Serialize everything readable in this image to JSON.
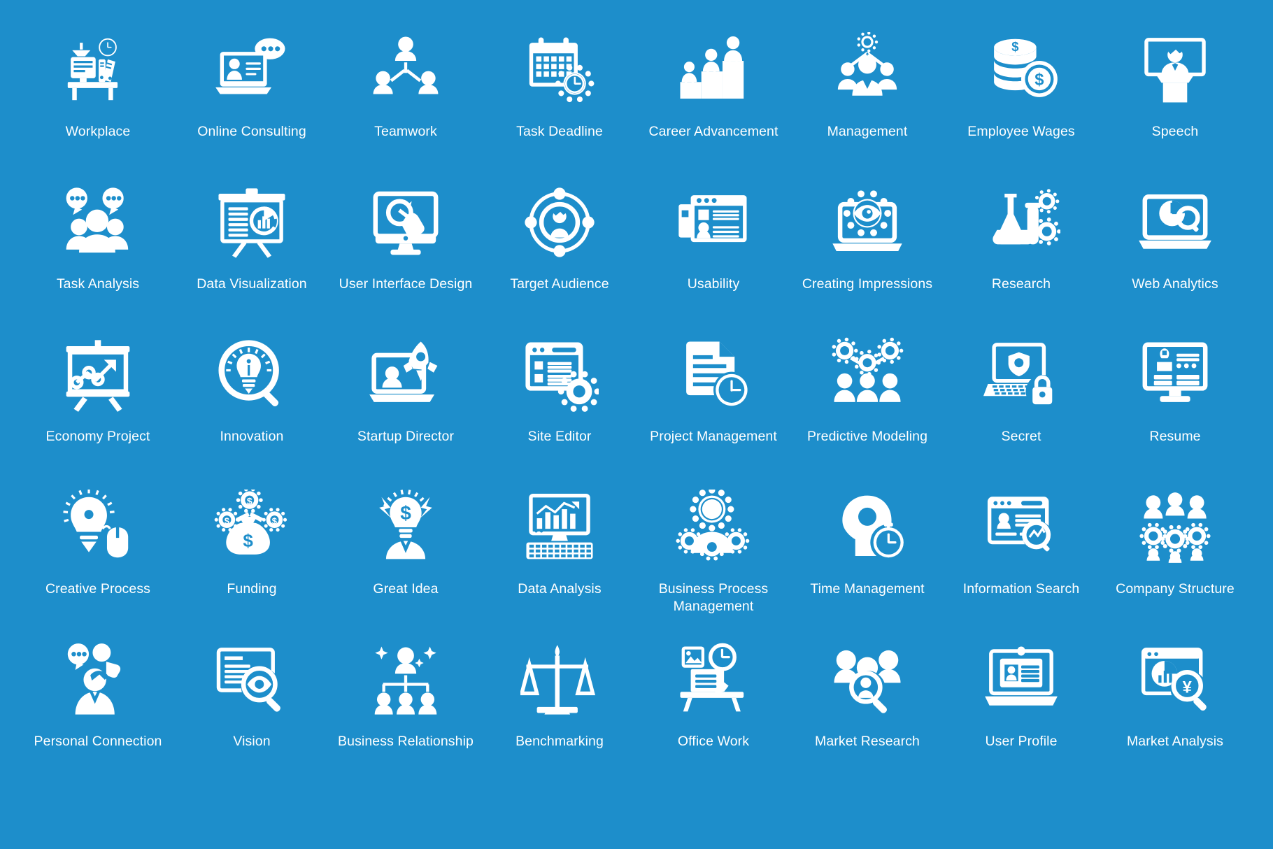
{
  "canvas": {
    "background_color": "#1d8ecb",
    "icon_color": "#ffffff",
    "columns": 8,
    "rows": 5,
    "total_icons": 40
  },
  "icons": [
    {
      "id": "workplace",
      "label": "Workplace",
      "icon_name": "desk-lamp-computer-clock-icon"
    },
    {
      "id": "online-consulting",
      "label": "Online Consulting",
      "icon_name": "laptop-user-chat-bubble-icon"
    },
    {
      "id": "teamwork",
      "label": "Teamwork",
      "icon_name": "three-people-hierarchy-icon"
    },
    {
      "id": "task-deadline",
      "label": "Task Deadline",
      "icon_name": "calendar-gear-clock-icon"
    },
    {
      "id": "career-advancement",
      "label": "Career Advancement",
      "icon_name": "people-on-steps-icon"
    },
    {
      "id": "management",
      "label": "Management",
      "icon_name": "team-gear-network-icon"
    },
    {
      "id": "employee-wages",
      "label": "Employee Wages",
      "icon_name": "coin-stack-dollar-icon"
    },
    {
      "id": "speech",
      "label": "Speech",
      "icon_name": "speaker-podium-screen-icon"
    },
    {
      "id": "task-analysis",
      "label": "Task Analysis",
      "icon_name": "people-speech-bubbles-icon"
    },
    {
      "id": "data-visualization",
      "label": "Data Visualization",
      "icon_name": "presentation-board-chart-icon"
    },
    {
      "id": "user-interface-design",
      "label": "User Interface Design",
      "icon_name": "monitor-cursor-click-icon"
    },
    {
      "id": "target-audience",
      "label": "Target Audience",
      "icon_name": "user-in-target-circle-icon"
    },
    {
      "id": "usability",
      "label": "Usability",
      "icon_name": "browser-windows-profile-icon"
    },
    {
      "id": "creating-impressions",
      "label": "Creating Impressions",
      "icon_name": "laptop-eye-gear-icon"
    },
    {
      "id": "research",
      "label": "Research",
      "icon_name": "flask-test-tube-gears-icon"
    },
    {
      "id": "web-analytics",
      "label": "Web Analytics",
      "icon_name": "laptop-pie-chart-magnifier-icon"
    },
    {
      "id": "economy-project",
      "label": "Economy Project",
      "icon_name": "board-line-graph-arrow-icon"
    },
    {
      "id": "innovation",
      "label": "Innovation",
      "icon_name": "lightbulb-magnifier-icon"
    },
    {
      "id": "startup-director",
      "label": "Startup Director",
      "icon_name": "laptop-rocket-user-icon"
    },
    {
      "id": "site-editor",
      "label": "Site Editor",
      "icon_name": "browser-window-gear-icon"
    },
    {
      "id": "project-management",
      "label": "Project Management",
      "icon_name": "document-clock-icon"
    },
    {
      "id": "predictive-modeling",
      "label": "Predictive Modeling",
      "icon_name": "gears-people-network-icon"
    },
    {
      "id": "secret",
      "label": "Secret",
      "icon_name": "laptop-shield-padlock-icon"
    },
    {
      "id": "resume",
      "label": "Resume",
      "icon_name": "monitor-cv-profile-icon"
    },
    {
      "id": "creative-process",
      "label": "Creative Process",
      "icon_name": "lightbulb-gear-mouse-icon"
    },
    {
      "id": "funding",
      "label": "Funding",
      "icon_name": "money-bag-coin-plant-icon"
    },
    {
      "id": "great-idea",
      "label": "Great Idea",
      "icon_name": "businessman-lightbulb-dollar-icon"
    },
    {
      "id": "data-analysis",
      "label": "Data Analysis",
      "icon_name": "monitor-chart-keyboard-icon"
    },
    {
      "id": "business-process-management",
      "label": "Business Process Management",
      "icon_name": "person-gears-icon"
    },
    {
      "id": "time-management",
      "label": "Time Management",
      "icon_name": "head-gear-stopwatch-icon"
    },
    {
      "id": "information-search",
      "label": "Information Search",
      "icon_name": "browser-profile-magnifier-icon"
    },
    {
      "id": "company-structure",
      "label": "Company Structure",
      "icon_name": "people-gears-structure-icon"
    },
    {
      "id": "personal-connection",
      "label": "Personal Connection",
      "icon_name": "person-chat-phone-icon"
    },
    {
      "id": "vision",
      "label": "Vision",
      "icon_name": "board-eye-magnifier-icon"
    },
    {
      "id": "business-relationship",
      "label": "Business Relationship",
      "icon_name": "people-org-chart-stars-icon"
    },
    {
      "id": "benchmarking",
      "label": "Benchmarking",
      "icon_name": "balance-scale-icon"
    },
    {
      "id": "office-work",
      "label": "Office Work",
      "icon_name": "desk-document-clock-photo-icon"
    },
    {
      "id": "market-research",
      "label": "Market Research",
      "icon_name": "people-magnifier-icon"
    },
    {
      "id": "user-profile",
      "label": "User Profile",
      "icon_name": "laptop-id-card-icon"
    },
    {
      "id": "market-analysis",
      "label": "Market Analysis",
      "icon_name": "browser-chart-yen-magnifier-icon"
    }
  ]
}
